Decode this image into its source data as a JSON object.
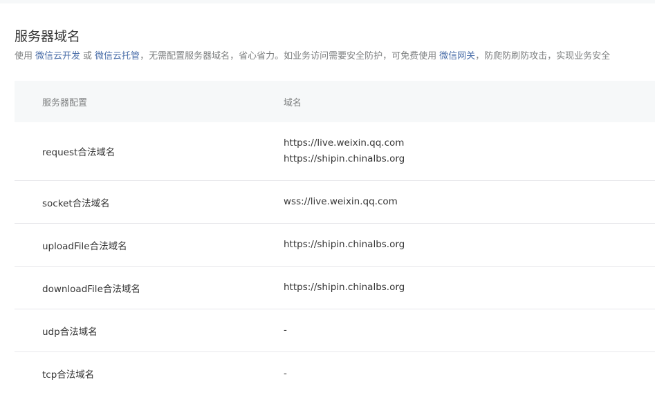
{
  "section": {
    "title": "服务器域名",
    "desc_prefix": "使用",
    "link_cloud_dev": "微信云开发",
    "desc_or": "或",
    "link_cloud_host": "微信云托管",
    "desc_mid": "，无需配置服务器域名，省心省力。如业务访问需要安全防护，可免费使用",
    "link_gateway": "微信网关",
    "desc_suffix": "，防爬防刷防攻击，实现业务安全"
  },
  "table": {
    "headers": [
      "服务器配置",
      "域名"
    ],
    "rows": [
      {
        "label": "request合法域名",
        "domains": [
          "https://live.weixin.qq.com",
          "https://shipin.chinalbs.org"
        ]
      },
      {
        "label": "socket合法域名",
        "domains": [
          "wss://live.weixin.qq.com"
        ]
      },
      {
        "label": "uploadFile合法域名",
        "domains": [
          "https://shipin.chinalbs.org"
        ]
      },
      {
        "label": "downloadFile合法域名",
        "domains": [
          "https://shipin.chinalbs.org"
        ]
      },
      {
        "label": "udp合法域名",
        "domains": [
          "-"
        ]
      },
      {
        "label": "tcp合法域名",
        "domains": [
          "-"
        ]
      }
    ]
  }
}
